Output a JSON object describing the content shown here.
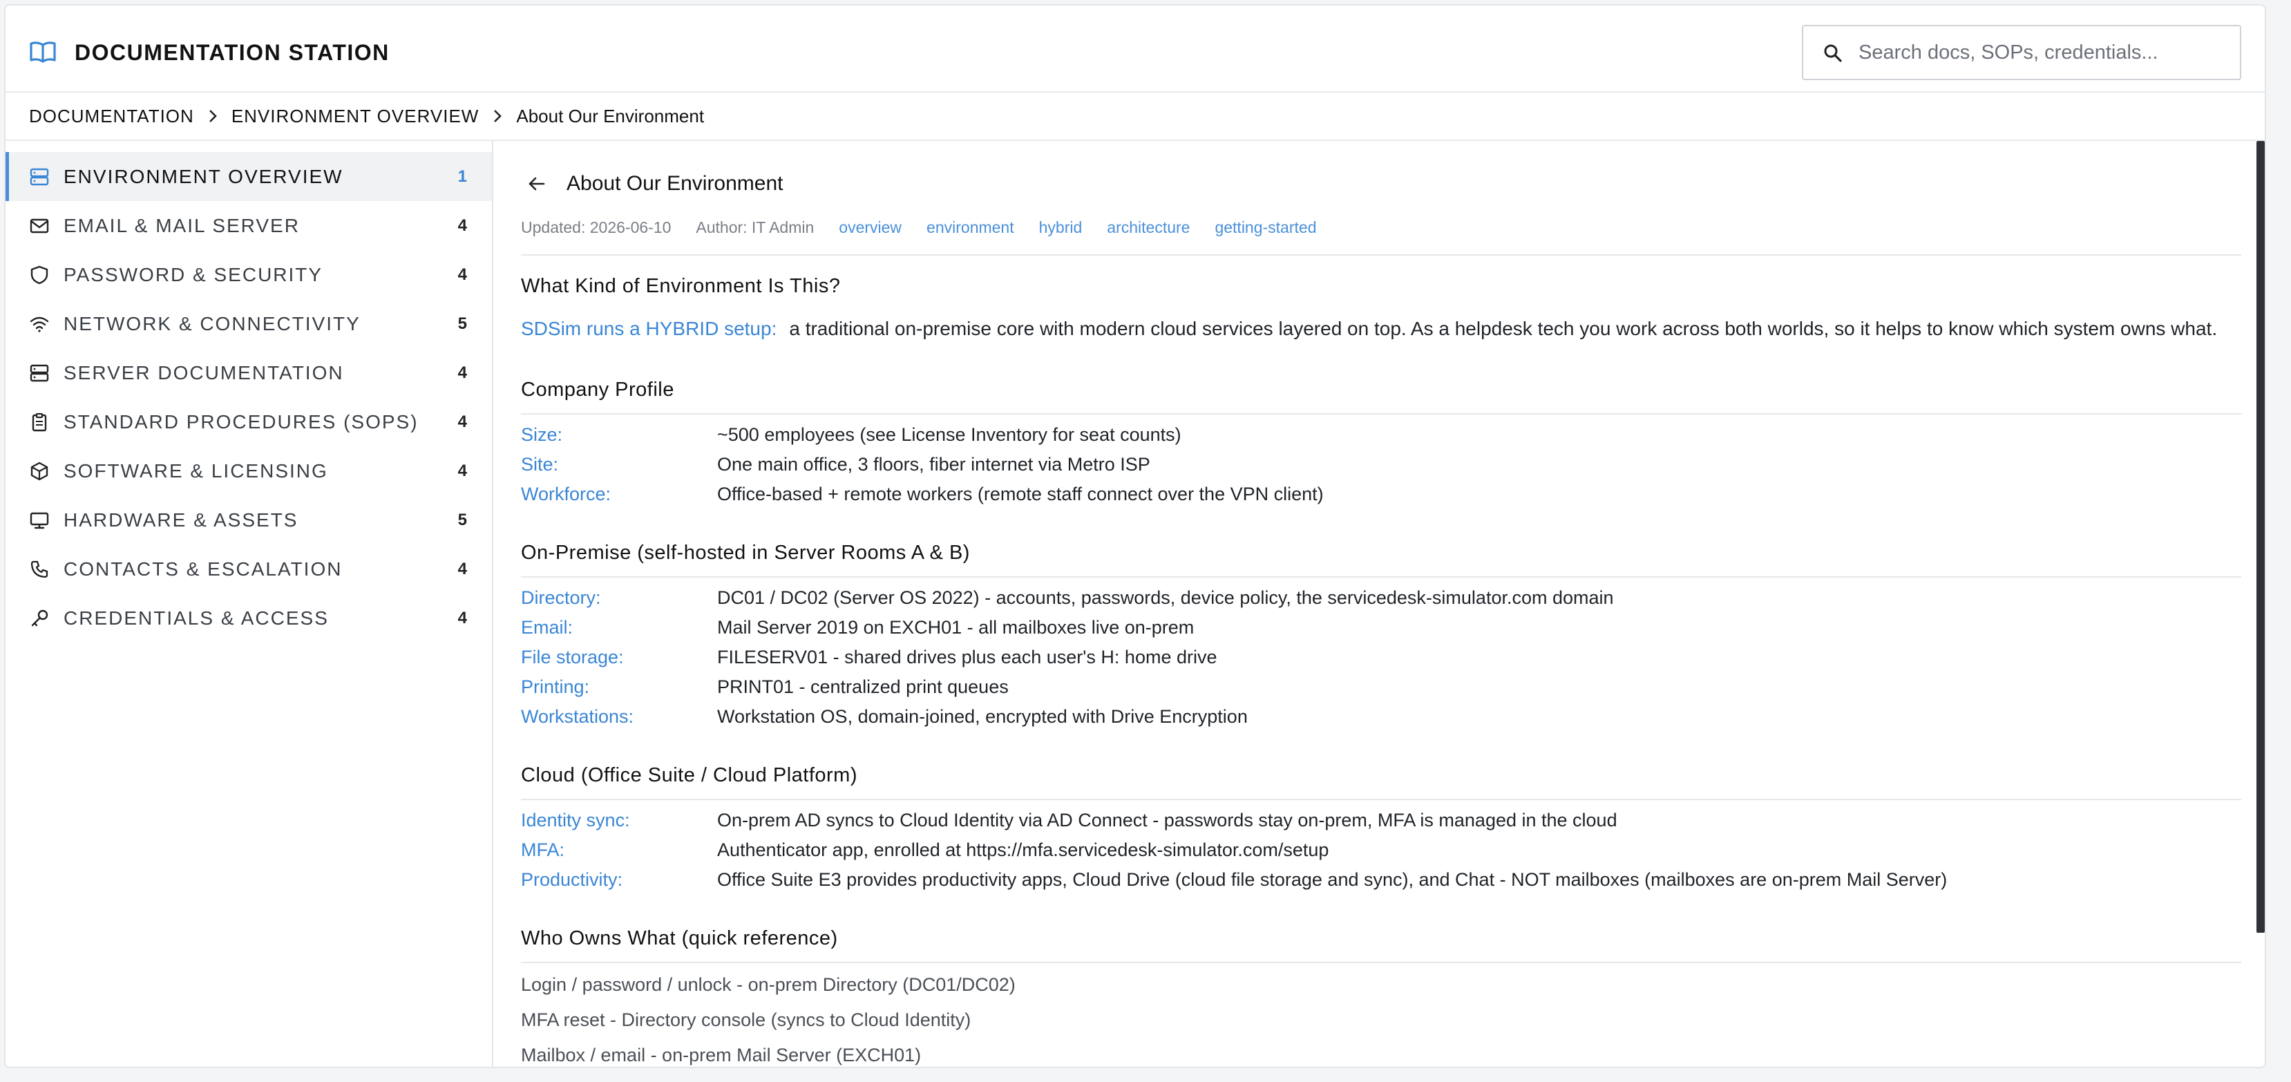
{
  "app": {
    "title": "DOCUMENTATION STATION",
    "search_placeholder": "Search docs, SOPs, credentials...",
    "accent_color": "#4a90d9"
  },
  "breadcrumb": [
    "DOCUMENTATION",
    "ENVIRONMENT OVERVIEW",
    "About Our Environment"
  ],
  "sidebar": {
    "items": [
      {
        "label": "ENVIRONMENT OVERVIEW",
        "count": "1",
        "icon": "server-stack-icon",
        "active": true
      },
      {
        "label": "EMAIL & MAIL SERVER",
        "count": "4",
        "icon": "envelope-icon"
      },
      {
        "label": "PASSWORD & SECURITY",
        "count": "4",
        "icon": "shield-icon"
      },
      {
        "label": "NETWORK & CONNECTIVITY",
        "count": "5",
        "icon": "wifi-icon"
      },
      {
        "label": "SERVER DOCUMENTATION",
        "count": "4",
        "icon": "server-icon"
      },
      {
        "label": "STANDARD PROCEDURES (SOPS)",
        "count": "4",
        "icon": "clipboard-icon"
      },
      {
        "label": "SOFTWARE & LICENSING",
        "count": "4",
        "icon": "package-icon"
      },
      {
        "label": "HARDWARE & ASSETS",
        "count": "5",
        "icon": "monitor-icon"
      },
      {
        "label": "CONTACTS & ESCALATION",
        "count": "4",
        "icon": "phone-icon"
      },
      {
        "label": "CREDENTIALS & ACCESS",
        "count": "4",
        "icon": "key-icon"
      }
    ]
  },
  "doc": {
    "title": "About Our Environment",
    "updated": "Updated: 2026-06-10",
    "author": "Author: IT Admin",
    "tags": [
      "overview",
      "environment",
      "hybrid",
      "architecture",
      "getting-started"
    ],
    "section1": {
      "title": "What Kind of Environment Is This?",
      "lead": "SDSim runs a HYBRID setup:",
      "text": "a traditional on-premise core with modern cloud services layered on top. As a helpdesk tech you work across both worlds, so it helps to know which system owns what."
    },
    "section2": {
      "title": "Company Profile",
      "rows": [
        {
          "key": "Size:",
          "value": "~500 employees (see License Inventory for seat counts)"
        },
        {
          "key": "Site:",
          "value": "One main office, 3 floors, fiber internet via Metro ISP"
        },
        {
          "key": "Workforce:",
          "value": "Office-based + remote workers (remote staff connect over the VPN client)"
        }
      ]
    },
    "section3": {
      "title": "On-Premise (self-hosted in Server Rooms A & B)",
      "rows": [
        {
          "key": "Directory:",
          "value": "DC01 / DC02 (Server OS 2022) - accounts, passwords, device policy, the servicedesk-simulator.com domain"
        },
        {
          "key": "Email:",
          "value": "Mail Server 2019 on EXCH01 - all mailboxes live on-prem"
        },
        {
          "key": "File storage:",
          "value": "FILESERV01 - shared drives plus each user's H: home drive"
        },
        {
          "key": "Printing:",
          "value": "PRINT01 - centralized print queues"
        },
        {
          "key": "Workstations:",
          "value": "Workstation OS, domain-joined, encrypted with Drive Encryption"
        }
      ]
    },
    "section4": {
      "title": "Cloud (Office Suite / Cloud Platform)",
      "rows": [
        {
          "key": "Identity sync:",
          "value": "On-prem AD syncs to Cloud Identity via AD Connect - passwords stay on-prem, MFA is managed in the cloud"
        },
        {
          "key": "MFA:",
          "value": "Authenticator app, enrolled at https://mfa.servicedesk-simulator.com/setup"
        },
        {
          "key": "Productivity:",
          "value": "Office Suite E3 provides productivity apps, Cloud Drive (cloud file storage and sync), and Chat - NOT mailboxes (mailboxes are on-prem Mail Server)"
        }
      ]
    },
    "section5": {
      "title": "Who Owns What (quick reference)",
      "lines": [
        "Login / password / unlock - on-prem Directory (DC01/DC02)",
        "MFA reset - Directory console (syncs to Cloud Identity)",
        "Mailbox / email - on-prem Mail Server (EXCH01)"
      ]
    }
  }
}
